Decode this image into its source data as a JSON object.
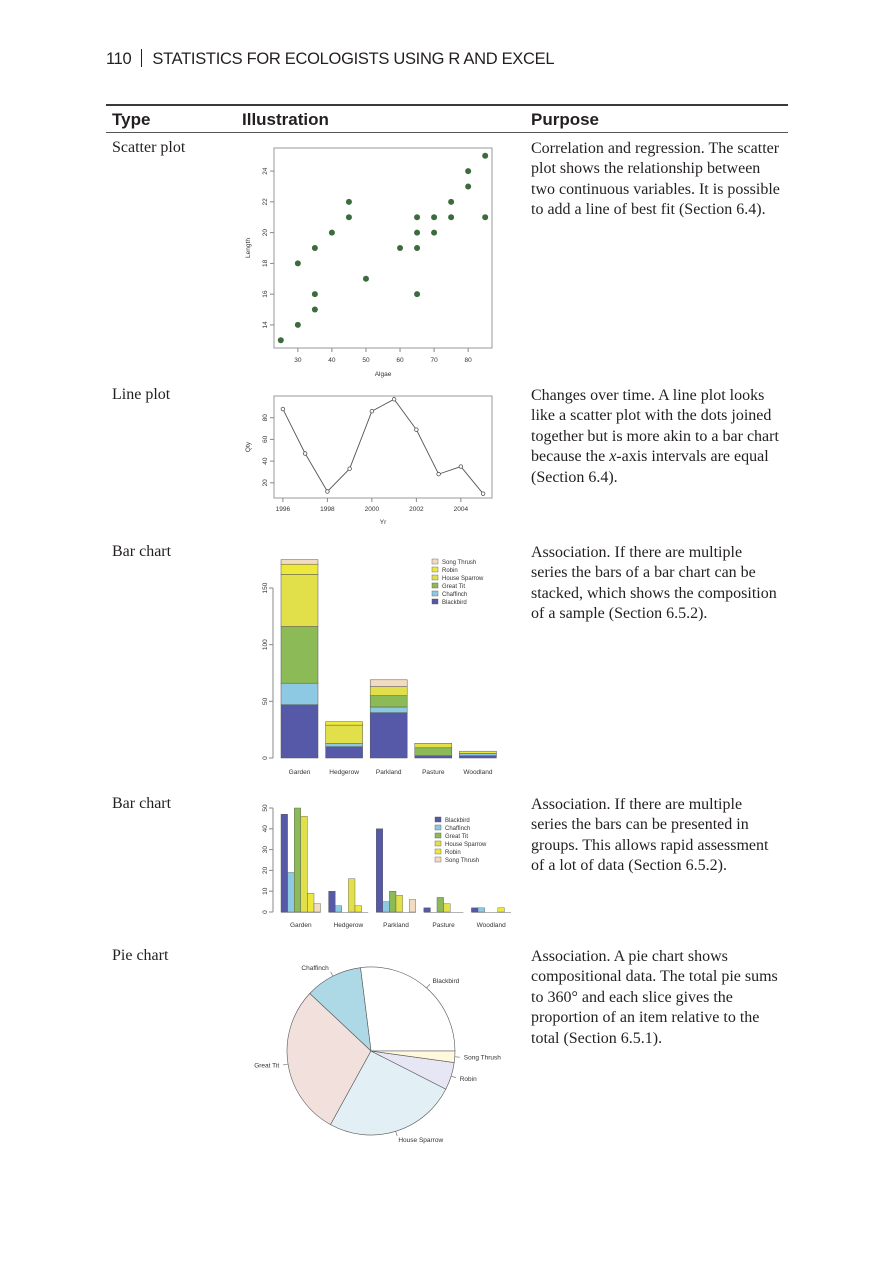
{
  "running_head": {
    "page_number": "110",
    "title": "STATISTICS FOR ECOLOGISTS USING R AND EXCEL"
  },
  "table": {
    "headers": {
      "type": "Type",
      "illustration": "Illustration",
      "purpose": "Purpose"
    },
    "rows": [
      {
        "type": "Scatter plot",
        "purpose": "Correlation and regression. The scatter plot shows the relationship between two continuous variables. It is possible to add a line of best fit (Section 6.4)."
      },
      {
        "type": "Line plot",
        "purpose_pre": "Changes over time. A line plot looks like a scatter plot with the dots joined together but is more akin to a bar chart because the ",
        "purpose_em": "x",
        "purpose_post": "-axis intervals are equal (Section 6.4)."
      },
      {
        "type": "Bar chart",
        "purpose": "Association. If there are multiple series the bars of a bar chart can be stacked, which shows the composition of a sample (Section 6.5.2)."
      },
      {
        "type": "Bar chart",
        "purpose": "Association. If there are multiple series the bars can be presented in groups. This allows rapid assessment of a lot of data (Section 6.5.2)."
      },
      {
        "type": "Pie chart",
        "purpose": "Association. A pie chart shows compositional data. The total pie sums to 360° and each slice gives the proportion of an item relative to the total (Section 6.5.1)."
      }
    ]
  },
  "colors": {
    "species": {
      "Blackbird": "#5559a8",
      "Chaffinch": "#8ec9e4",
      "Great Tit": "#8cba56",
      "House Sparrow": "#e2e04a",
      "Robin": "#eee83a",
      "Song Thrush": "#f2dcc0"
    },
    "pie": {
      "Blackbird": "#ffffff",
      "Chaffinch": "#add8e6",
      "Great Tit": "#f1e0dc",
      "House Sparrow": "#e2f0f5",
      "Robin": "#e6e6f5",
      "Song Thrush": "#fff8dc"
    },
    "scatter_point": "#3d6b3d"
  },
  "chart_data": [
    {
      "type": "scatter",
      "title": "",
      "xlabel": "Algae",
      "ylabel": "Length",
      "xlim": [
        23,
        87
      ],
      "ylim": [
        12.5,
        25.5
      ],
      "xticks": [
        30,
        40,
        50,
        60,
        70,
        80
      ],
      "yticks": [
        14,
        16,
        18,
        20,
        22,
        24
      ],
      "points": [
        [
          25,
          13
        ],
        [
          30,
          14
        ],
        [
          30,
          18
        ],
        [
          35,
          15
        ],
        [
          35,
          16
        ],
        [
          35,
          19
        ],
        [
          40,
          20
        ],
        [
          45,
          21
        ],
        [
          45,
          22
        ],
        [
          50,
          17
        ],
        [
          60,
          19
        ],
        [
          65,
          16
        ],
        [
          65,
          19
        ],
        [
          65,
          20
        ],
        [
          65,
          21
        ],
        [
          70,
          20
        ],
        [
          70,
          21
        ],
        [
          75,
          21
        ],
        [
          75,
          22
        ],
        [
          80,
          23
        ],
        [
          80,
          24
        ],
        [
          85,
          21
        ],
        [
          85,
          25
        ]
      ]
    },
    {
      "type": "line",
      "title": "",
      "xlabel": "Yr",
      "ylabel": "Qty",
      "xlim": [
        1995.6,
        2005.4
      ],
      "ylim": [
        6,
        100
      ],
      "xticks": [
        1996,
        1998,
        2000,
        2002,
        2004
      ],
      "yticks": [
        20,
        40,
        60,
        80
      ],
      "x": [
        1996,
        1997,
        1998,
        1999,
        2000,
        2001,
        2002,
        2003,
        2004,
        2005
      ],
      "y": [
        88,
        47,
        12,
        33,
        86,
        97,
        69,
        28,
        35,
        10
      ]
    },
    {
      "type": "bar",
      "stacked": true,
      "title": "",
      "xlabel": "",
      "ylabel": "",
      "ylim": [
        0,
        180
      ],
      "yticks": [
        0,
        50,
        100,
        150
      ],
      "categories": [
        "Garden",
        "Hedgerow",
        "Parkland",
        "Pasture",
        "Woodland"
      ],
      "series": [
        {
          "name": "Blackbird",
          "values": [
            47,
            10,
            40,
            2,
            2
          ]
        },
        {
          "name": "Chaffinch",
          "values": [
            19,
            3,
            5,
            0,
            2
          ]
        },
        {
          "name": "Great Tit",
          "values": [
            50,
            0,
            10,
            7,
            0
          ]
        },
        {
          "name": "House Sparrow",
          "values": [
            46,
            16,
            8,
            4,
            0
          ]
        },
        {
          "name": "Robin",
          "values": [
            9,
            3,
            0,
            0,
            2
          ]
        },
        {
          "name": "Song Thrush",
          "values": [
            4,
            0,
            6,
            0,
            0
          ]
        }
      ],
      "legend": {
        "position": "top-right",
        "entries": [
          "Song Thrush",
          "Robin",
          "House Sparrow",
          "Great Tit",
          "Chaffinch",
          "Blackbird"
        ]
      }
    },
    {
      "type": "bar",
      "stacked": false,
      "title": "",
      "xlabel": "",
      "ylabel": "",
      "ylim": [
        0,
        50
      ],
      "yticks": [
        0,
        10,
        20,
        30,
        40,
        50
      ],
      "categories": [
        "Garden",
        "Hedgerow",
        "Parkland",
        "Pasture",
        "Woodland"
      ],
      "series": [
        {
          "name": "Blackbird",
          "values": [
            47,
            10,
            40,
            2,
            2
          ]
        },
        {
          "name": "Chaffinch",
          "values": [
            19,
            3,
            5,
            0,
            2
          ]
        },
        {
          "name": "Great Tit",
          "values": [
            50,
            0,
            10,
            7,
            0
          ]
        },
        {
          "name": "House Sparrow",
          "values": [
            46,
            16,
            8,
            4,
            0
          ]
        },
        {
          "name": "Robin",
          "values": [
            9,
            3,
            0,
            0,
            2
          ]
        },
        {
          "name": "Song Thrush",
          "values": [
            4,
            0,
            6,
            0,
            0
          ]
        }
      ],
      "legend": {
        "position": "top-right",
        "entries": [
          "Blackbird",
          "Chaffinch",
          "Great Tit",
          "House Sparrow",
          "Robin",
          "Song Thrush"
        ]
      }
    },
    {
      "type": "pie",
      "title": "",
      "labels": [
        "Blackbird",
        "Chaffinch",
        "Great Tit",
        "House Sparrow",
        "Robin",
        "Song Thrush"
      ],
      "values": [
        27,
        11,
        29,
        25.5,
        5.3,
        2.2
      ],
      "units": "percent (estimated)",
      "start": "3 o'clock, counter-clockwise"
    }
  ]
}
